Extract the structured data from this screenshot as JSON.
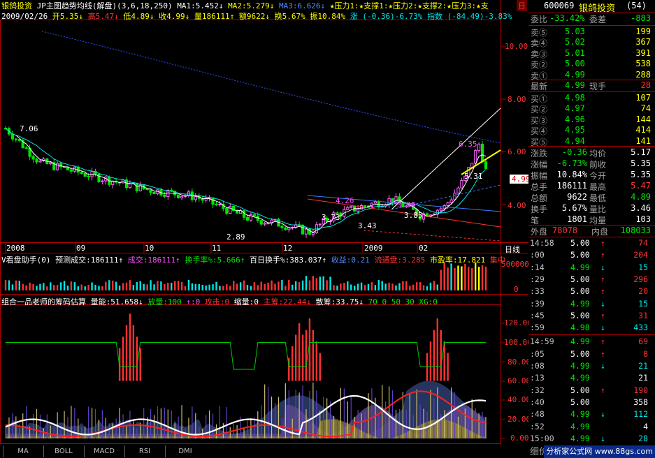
{
  "header": {
    "stock_name": "银鸽投资",
    "indicator": "JP主图趋势均线(解盘)",
    "params": "(3,6,18,250)",
    "ma1": "MA1:5.452↓",
    "ma2": "MA2:5.279↓",
    "ma3": "MA3:6.626↓",
    "flags": "★压力1:★支撑1:★压力2:★支撑2:★压力3:★支",
    "right_tag": "日"
  },
  "info_line": {
    "date": "2009/02/26",
    "open": "开5.35↓",
    "high": "高5.47↓",
    "low": "低4.89↓",
    "close": "收4.99↓",
    "volume": "量186111↑",
    "amount": "额9622↓",
    "turnover": "换5.67%",
    "amplitude": "振10.84%",
    "change": "涨 (-0.36)-6.73%",
    "index": "指数 (-84.49)-3.83%"
  },
  "main_axis": [
    "10.00",
    "8.00",
    "6.00",
    "4.00"
  ],
  "annotations": {
    "high_label": "7.06",
    "low_label": "2.89",
    "p1": "3.73",
    "p2": "3.43",
    "p3": "3.85",
    "p4": "6.35",
    "p5": "5.31",
    "p6": "4.26",
    "p7": "3.99",
    "current_price_tag": "4.99"
  },
  "date_axis": [
    "2008",
    "09",
    "10",
    "11",
    "12",
    "2009",
    "02"
  ],
  "period_label": "日线",
  "vol_panel": {
    "title": "V看盘助手(0)",
    "forecast": "预测成交:186111↑",
    "volume": "成交:186111↑",
    "turnover_rate": "换手率%:5.666↑",
    "hundred_day": "百日换手%:383.037↑",
    "profit": "收益:0.21",
    "float_shares": "流通盘:3.285",
    "pe": "市盈率:17.821",
    "tail": "集中",
    "axis_top": "500000",
    "axis_zero": "0"
  },
  "chip_panel": {
    "title": "组合一品老师的筹码估算",
    "energy": "量能:51.658↓",
    "volume_flag": "放量:100",
    "item3": "↑:0",
    "attack": "攻击:0",
    "shrink": "缩量:0",
    "main_chips": "主筹:22.44↓",
    "scattered": "散筹:33.75↓",
    "tail": "70 0 50 30 XG:0",
    "axis": [
      "120.00",
      "100.00",
      "80.00",
      "60.00",
      "40.00",
      "20.00",
      "0.00"
    ]
  },
  "tabs": [
    "MA",
    "BOLL",
    "MACD",
    "RSI",
    "DMI"
  ],
  "quote": {
    "code": "600069",
    "name": "银鸽投资",
    "page": "(54)",
    "ratio_label": "委比",
    "ratio": "-33.42%",
    "diff_label": "委差",
    "diff": "-883",
    "asks": [
      {
        "label": "卖⑤",
        "price": "5.03",
        "vol": "199"
      },
      {
        "label": "卖④",
        "price": "5.02",
        "vol": "367"
      },
      {
        "label": "卖③",
        "price": "5.01",
        "vol": "391"
      },
      {
        "label": "卖②",
        "price": "5.00",
        "vol": "538"
      },
      {
        "label": "卖①",
        "price": "4.99",
        "vol": "288"
      }
    ],
    "last_label": "最新",
    "last": "4.99",
    "hand_label": "现手",
    "hand": "28",
    "bids": [
      {
        "label": "买①",
        "price": "4.98",
        "vol": "107"
      },
      {
        "label": "买②",
        "price": "4.97",
        "vol": "74"
      },
      {
        "label": "买③",
        "price": "4.96",
        "vol": "144"
      },
      {
        "label": "买④",
        "price": "4.95",
        "vol": "414"
      },
      {
        "label": "买⑤",
        "price": "4.94",
        "vol": "141"
      }
    ],
    "stats": [
      {
        "l1": "涨跌",
        "v1": "-0.36",
        "l2": "均价",
        "v2": "5.17"
      },
      {
        "l1": "涨幅",
        "v1": "-6.73%",
        "l2": "前收",
        "v2": "5.35"
      },
      {
        "l1": "振幅",
        "v1": "10.84%",
        "l2": "今开",
        "v2": "5.35"
      },
      {
        "l1": "总手",
        "v1": "186111",
        "l2": "最高",
        "v2": "5.47"
      },
      {
        "l1": "总额",
        "v1": "9622",
        "l2": "最低",
        "v2": "4.89"
      },
      {
        "l1": "换手",
        "v1": "5.67%",
        "l2": "量比",
        "v2": "3.46"
      },
      {
        "l1": "笔",
        "v1": "1801",
        "l2": "均量",
        "v2": "103"
      }
    ],
    "outer_label": "外盘",
    "outer": "78078",
    "inner_label": "内盘",
    "inner": "108033",
    "ticks": [
      {
        "time": "14:58",
        "price": "5.00",
        "dir": "↑",
        "vol": "74"
      },
      {
        "time": ":00",
        "price": "5.00",
        "dir": "↑",
        "vol": "204"
      },
      {
        "time": ":14",
        "price": "4.99",
        "dir": "↓",
        "vol": "15"
      },
      {
        "time": ":29",
        "price": "5.00",
        "dir": "↑",
        "vol": "296"
      },
      {
        "time": ":33",
        "price": "5.00",
        "dir": "↑",
        "vol": "20"
      },
      {
        "time": ":39",
        "price": "4.99",
        "dir": "↓",
        "vol": "15"
      },
      {
        "time": ":45",
        "price": "5.00",
        "dir": "↑",
        "vol": "31"
      },
      {
        "time": ":59",
        "price": "4.98",
        "dir": "↓",
        "vol": "433"
      },
      {
        "time": "14:59",
        "price": "4.99",
        "dir": "↑",
        "vol": "69"
      },
      {
        "time": ":05",
        "price": "5.00",
        "dir": "↑",
        "vol": "8"
      },
      {
        "time": ":08",
        "price": "4.99",
        "dir": "↓",
        "vol": "21"
      },
      {
        "time": ":13",
        "price": "4.99",
        "dir": "",
        "vol": "21"
      },
      {
        "time": ":32",
        "price": "5.00",
        "dir": "↑",
        "vol": "190"
      },
      {
        "time": ":40",
        "price": "5.00",
        "dir": "",
        "vol": "358"
      },
      {
        "time": ":48",
        "price": "4.99",
        "dir": "↓",
        "vol": "112"
      },
      {
        "time": ":52",
        "price": "4.99",
        "dir": "",
        "vol": "4"
      },
      {
        "time": "15:00",
        "price": "4.99",
        "dir": "↓",
        "vol": "28"
      }
    ],
    "footer_label": "细价"
  },
  "watermark": "分析家公式网 www.88gs.com",
  "colors": {
    "up": "#ff3232",
    "down": "#00e600",
    "axis_red": "#b00000",
    "yellow": "#ffff00",
    "cyan": "#00e6e6"
  }
}
